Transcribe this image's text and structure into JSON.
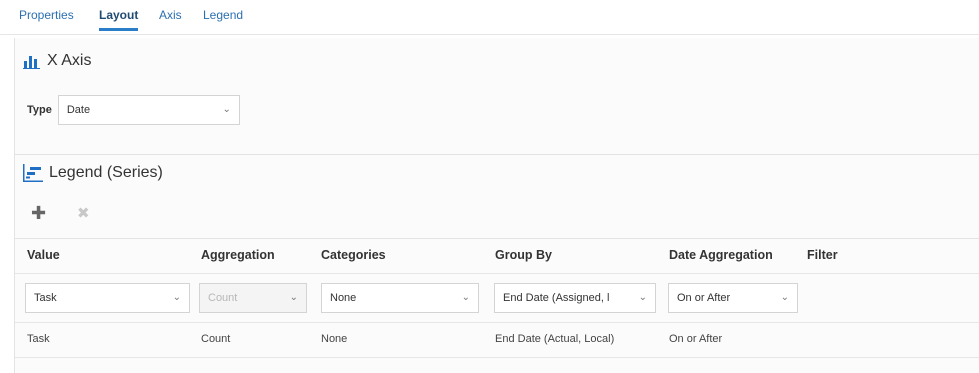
{
  "tabs": [
    {
      "label": "Properties",
      "active": false
    },
    {
      "label": "Layout",
      "active": true
    },
    {
      "label": "Axis",
      "active": false
    },
    {
      "label": "Legend",
      "active": false
    }
  ],
  "x_axis": {
    "title": "X Axis",
    "icon": "bar-chart-icon",
    "type_label": "Type",
    "type_value": "Date"
  },
  "legend": {
    "title": "Legend (Series)",
    "icon": "legend-series-icon",
    "add_icon": "plus-icon",
    "remove_icon": "close-icon",
    "columns": [
      "Value",
      "Aggregation",
      "Categories",
      "Group By",
      "Date Aggregation",
      "Filter"
    ],
    "edit_row": {
      "value": "Task",
      "aggregation": "Count",
      "categories": "None",
      "group_by": "End Date (Assigned, l",
      "date_aggregation": "On or After"
    },
    "rows": [
      {
        "value": "Task",
        "aggregation": "Count",
        "categories": "None",
        "group_by": "End Date (Actual, Local)",
        "date_aggregation": "On or After"
      }
    ]
  },
  "colors": {
    "accent": "#2a7dc7",
    "icon_blue": "#1f6fc4",
    "tab_text": "#2c6fb0"
  }
}
